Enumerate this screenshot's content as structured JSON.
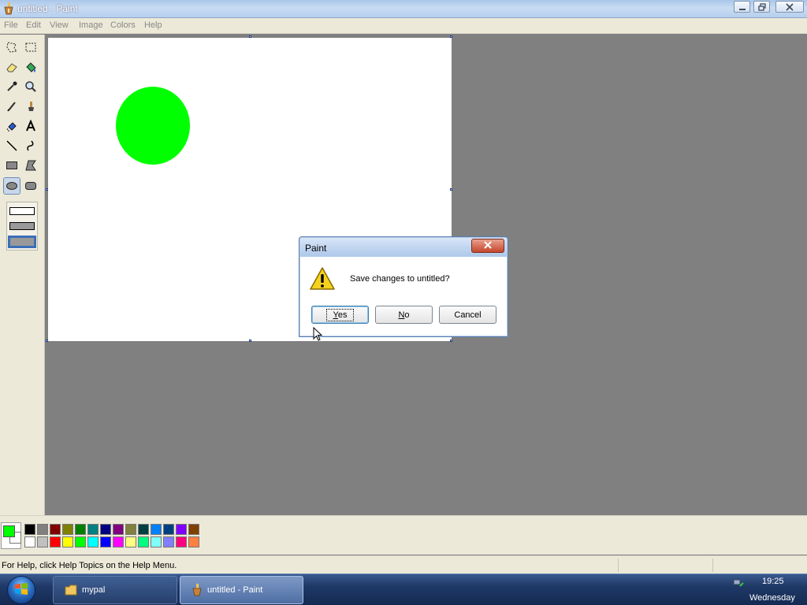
{
  "window": {
    "title": "untitled - Paint",
    "controls": [
      "minimize-icon",
      "restore-icon",
      "close-icon"
    ]
  },
  "menu": {
    "items": [
      "File",
      "Edit",
      "View",
      "Image",
      "Colors",
      "Help"
    ]
  },
  "toolbox": {
    "tools": [
      "free-form-select",
      "select",
      "eraser",
      "fill-with-color",
      "pick-color",
      "magnifier",
      "pencil",
      "brush",
      "airbrush",
      "text",
      "line",
      "curve",
      "rectangle",
      "polygon",
      "ellipse",
      "rounded-rectangle"
    ],
    "active_tool": "ellipse",
    "fill_options": [
      "outline",
      "outline-and-fill",
      "fill-only"
    ],
    "selected_fill_option": "fill-only"
  },
  "canvas": {
    "background": "#ffffff",
    "shapes": [
      {
        "type": "ellipse",
        "fill": "#00ff00"
      }
    ]
  },
  "palette": {
    "foreground": "#00ff00",
    "background": "#ffffff",
    "row1": [
      "#000000",
      "#808080",
      "#800000",
      "#808000",
      "#008000",
      "#008080",
      "#000080",
      "#800080",
      "#808040",
      "#004040",
      "#0080ff",
      "#004080",
      "#8000ff",
      "#804000"
    ],
    "row2": [
      "#ffffff",
      "#c0c0c0",
      "#ff0000",
      "#ffff00",
      "#00ff00",
      "#00ffff",
      "#0000ff",
      "#ff00ff",
      "#ffff80",
      "#00ff80",
      "#80ffff",
      "#8080ff",
      "#ff0080",
      "#ff8040"
    ]
  },
  "status": {
    "help_text": "For Help, click Help Topics on the Help Menu."
  },
  "dialog": {
    "title": "Paint",
    "message": "Save changes to untitled?",
    "icon": "warning-icon",
    "buttons": {
      "yes": {
        "mnemonic": "Y",
        "rest": "es"
      },
      "no": {
        "mnemonic": "N",
        "rest": "o"
      },
      "cancel": "Cancel"
    },
    "default_button": "yes"
  },
  "taskbar": {
    "start": "windows-orb-icon",
    "items": [
      {
        "label": "mypal",
        "icon": "folder-icon",
        "active": false
      },
      {
        "label": "untitled - Paint",
        "icon": "paint-icon",
        "active": true
      }
    ],
    "clock": {
      "time": "19:25",
      "day": "Wednesday"
    },
    "colors": {
      "accent": "#1f3866"
    }
  }
}
